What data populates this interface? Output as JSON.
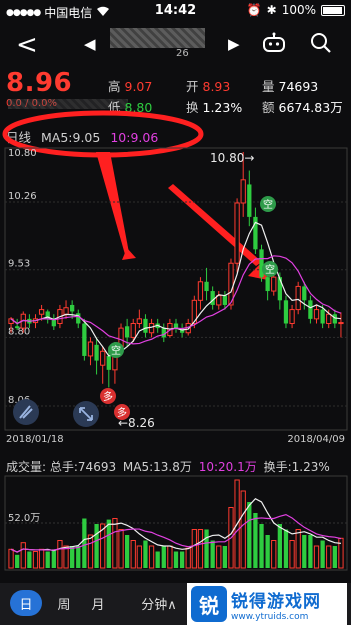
{
  "status_bar": {
    "carrier": "中国电信",
    "time": "14:42",
    "battery": "100%"
  },
  "nav": {
    "back": "<",
    "prev": "◀",
    "next": "▶",
    "stock_suffix": "26"
  },
  "quote": {
    "price": "8.96",
    "change": "0.0 / 0.0%",
    "high_label": "高",
    "high": "9.07",
    "low_label": "低",
    "low": "8.80",
    "open_label": "开",
    "open": "8.93",
    "turnover_label": "换",
    "turnover": "1.23%",
    "volume_label": "量",
    "volume": "74693",
    "amount_label": "额",
    "amount": "6674.83万"
  },
  "ma_bar": {
    "period": "日线",
    "ma5": "MA5:9.05",
    "ma10": "10:9.06"
  },
  "chart_data": {
    "type": "candlestick",
    "y_labels": [
      "10.26",
      "9.53",
      "8.80",
      "8.06"
    ],
    "top_label": "10.80",
    "annotations": {
      "high": "10.80→",
      "low": "←8.26",
      "sell": "空",
      "buy": "多"
    },
    "x_start": "2018/01/18",
    "x_end": "2018/04/09",
    "candles": [
      [
        8.95,
        9.0,
        8.85,
        9.02,
        "r"
      ],
      [
        8.92,
        8.9,
        8.88,
        9.0,
        "g"
      ],
      [
        8.9,
        9.05,
        8.85,
        9.08,
        "r"
      ],
      [
        9.0,
        8.95,
        8.9,
        9.05,
        "g"
      ],
      [
        8.96,
        9.0,
        8.9,
        9.05,
        "r"
      ],
      [
        9.05,
        9.1,
        8.98,
        9.15,
        "r"
      ],
      [
        9.08,
        9.0,
        8.95,
        9.1,
        "g"
      ],
      [
        9.0,
        8.92,
        8.88,
        9.05,
        "g"
      ],
      [
        8.95,
        9.1,
        8.9,
        9.15,
        "r"
      ],
      [
        9.05,
        9.12,
        9.0,
        9.2,
        "r"
      ],
      [
        9.15,
        9.08,
        9.0,
        9.2,
        "g"
      ],
      [
        9.06,
        8.95,
        8.9,
        9.1,
        "g"
      ],
      [
        8.95,
        8.6,
        8.55,
        9.0,
        "g"
      ],
      [
        8.6,
        8.75,
        8.5,
        8.8,
        "r"
      ],
      [
        8.72,
        8.55,
        8.4,
        8.8,
        "g"
      ],
      [
        8.5,
        8.65,
        8.3,
        8.7,
        "r"
      ],
      [
        8.6,
        8.45,
        8.26,
        8.7,
        "g"
      ],
      [
        8.45,
        8.7,
        8.3,
        8.75,
        "r"
      ],
      [
        8.7,
        8.9,
        8.6,
        8.95,
        "r"
      ],
      [
        8.92,
        8.8,
        8.7,
        9.0,
        "g"
      ],
      [
        8.8,
        8.95,
        8.75,
        9.0,
        "r"
      ],
      [
        8.95,
        9.0,
        8.9,
        9.1,
        "r"
      ],
      [
        9.0,
        8.85,
        8.8,
        9.05,
        "g"
      ],
      [
        8.85,
        8.95,
        8.8,
        9.0,
        "r"
      ],
      [
        8.95,
        8.9,
        8.85,
        9.0,
        "g"
      ],
      [
        8.9,
        8.8,
        8.75,
        8.95,
        "g"
      ],
      [
        8.82,
        8.95,
        8.8,
        9.0,
        "r"
      ],
      [
        8.95,
        8.9,
        8.85,
        9.0,
        "g"
      ],
      [
        8.9,
        8.85,
        8.8,
        8.95,
        "g"
      ],
      [
        8.85,
        8.95,
        8.82,
        9.0,
        "r"
      ],
      [
        8.95,
        9.2,
        8.9,
        9.25,
        "r"
      ],
      [
        9.2,
        9.4,
        9.1,
        9.45,
        "r"
      ],
      [
        9.4,
        9.3,
        9.2,
        9.55,
        "g"
      ],
      [
        9.3,
        9.15,
        9.1,
        9.35,
        "g"
      ],
      [
        9.15,
        9.25,
        9.1,
        9.3,
        "r"
      ],
      [
        9.25,
        9.15,
        9.1,
        9.3,
        "g"
      ],
      [
        9.15,
        9.6,
        9.1,
        9.65,
        "r"
      ],
      [
        9.6,
        10.25,
        9.5,
        10.3,
        "r"
      ],
      [
        10.25,
        10.5,
        10.1,
        10.8,
        "r"
      ],
      [
        10.45,
        10.1,
        10.0,
        10.6,
        "g"
      ],
      [
        10.1,
        9.75,
        9.7,
        10.2,
        "g"
      ],
      [
        9.75,
        9.45,
        9.4,
        9.8,
        "g"
      ],
      [
        9.45,
        9.3,
        9.2,
        9.5,
        "g"
      ],
      [
        9.3,
        9.45,
        9.25,
        9.5,
        "r"
      ],
      [
        9.45,
        9.2,
        9.1,
        9.5,
        "g"
      ],
      [
        9.2,
        8.95,
        8.9,
        9.25,
        "g"
      ],
      [
        8.95,
        9.1,
        8.9,
        9.15,
        "r"
      ],
      [
        9.1,
        9.35,
        9.05,
        9.4,
        "r"
      ],
      [
        9.35,
        9.2,
        9.1,
        9.4,
        "g"
      ],
      [
        9.2,
        9.0,
        8.95,
        9.25,
        "g"
      ],
      [
        9.0,
        9.1,
        8.95,
        9.15,
        "r"
      ],
      [
        9.1,
        8.95,
        8.9,
        9.15,
        "g"
      ],
      [
        8.95,
        9.05,
        8.9,
        9.1,
        "r"
      ],
      [
        9.05,
        8.95,
        8.9,
        9.1,
        "g"
      ],
      [
        8.95,
        8.96,
        8.8,
        9.07,
        "r"
      ]
    ]
  },
  "volume": {
    "label": "成交量:",
    "total": "总手:74693",
    "ma5": "MA5:13.8万",
    "ma10": "10:20.1万",
    "turnover": "换手:1.23%",
    "axis_label": "52.0万"
  },
  "tabs": [
    "日",
    "周",
    "月",
    "分钟∧"
  ],
  "watermark": {
    "title": "锐得游戏网",
    "url": "www.ytruids.com"
  }
}
